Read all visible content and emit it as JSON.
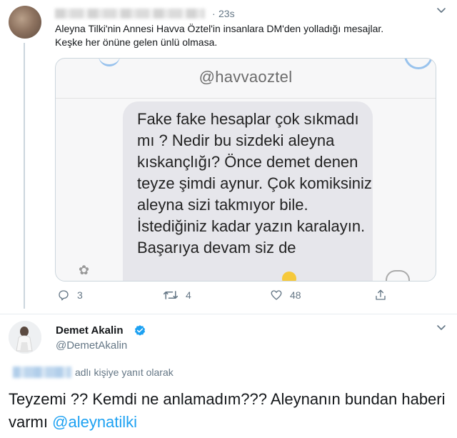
{
  "tweet1": {
    "time": "23s",
    "dot": "·",
    "text_line1": "Aleyna Tilki'nin Annesi Havva Öztel'in insanlara DM'den yolladığı mesajlar.",
    "text_line2": "Keşke her önüne gelen ünlü olmasa.",
    "media": {
      "handle": "@havvaoztel",
      "bubble_text": "Fake fake hesaplar çok sıkmadı mı ? Nedir bu sizdeki aleyna kıskançlığı? Önce demet denen teyze şimdi aynur. Çok komiksiniz aleyna sizi takmıyor bile. İstediğiniz kadar yazın karalayın. Başarıya devam siz de"
    },
    "actions": {
      "replies": "3",
      "retweets": "4",
      "likes": "48"
    }
  },
  "tweet2": {
    "name": "Demet Akalin",
    "handle": "@DemetAkalin",
    "reply_context": "adlı kişiye yanıt olarak",
    "text": "Teyzemi ?? Kemdi ne anlamadım??? Aleynanın bundan haberi varmı ",
    "mention": "@aleynatilki"
  },
  "colors": {
    "accent": "#1da1f2",
    "muted": "#657786",
    "border": "#ccd6dd"
  }
}
